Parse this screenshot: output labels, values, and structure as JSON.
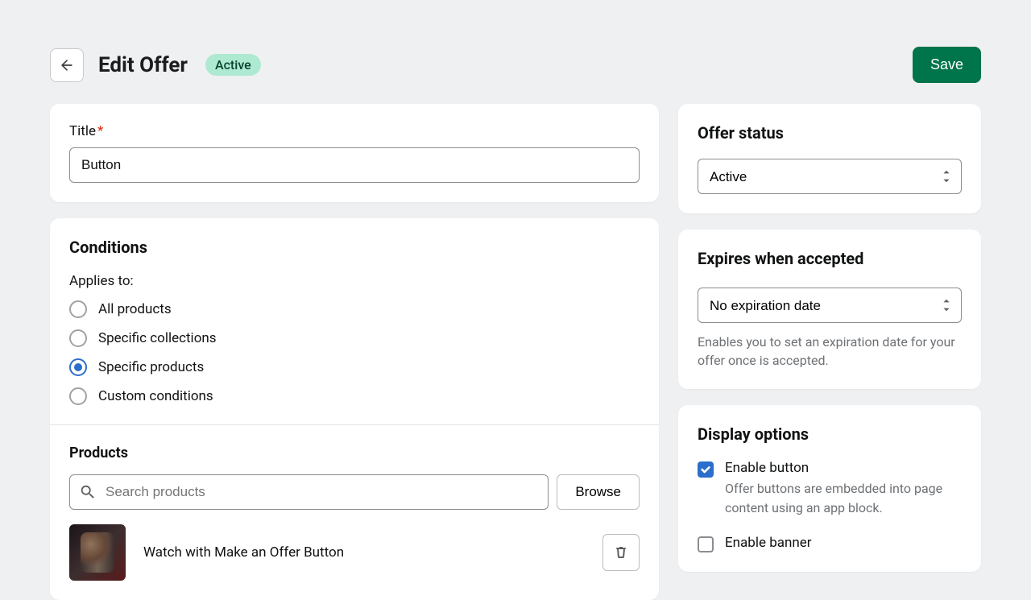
{
  "header": {
    "title": "Edit Offer",
    "badge": "Active",
    "save_label": "Save"
  },
  "title_field": {
    "label": "Title",
    "value": "Button"
  },
  "conditions": {
    "heading": "Conditions",
    "applies_label": "Applies to:",
    "options": [
      {
        "label": "All products",
        "selected": false
      },
      {
        "label": "Specific collections",
        "selected": false
      },
      {
        "label": "Specific products",
        "selected": true
      },
      {
        "label": "Custom conditions",
        "selected": false
      }
    ]
  },
  "products": {
    "heading": "Products",
    "search_placeholder": "Search products",
    "browse_label": "Browse",
    "items": [
      {
        "name": "Watch with Make an Offer Button"
      }
    ]
  },
  "status_card": {
    "heading": "Offer status",
    "selected": "Active"
  },
  "expires_card": {
    "heading": "Expires when accepted",
    "selected": "No expiration date",
    "help": "Enables you to set an expiration date for your offer once is accepted."
  },
  "display_card": {
    "heading": "Display options",
    "options": [
      {
        "label": "Enable button",
        "desc": "Offer buttons are embedded into page content using an app block.",
        "checked": true
      },
      {
        "label": "Enable banner",
        "desc": "",
        "checked": false
      }
    ]
  }
}
